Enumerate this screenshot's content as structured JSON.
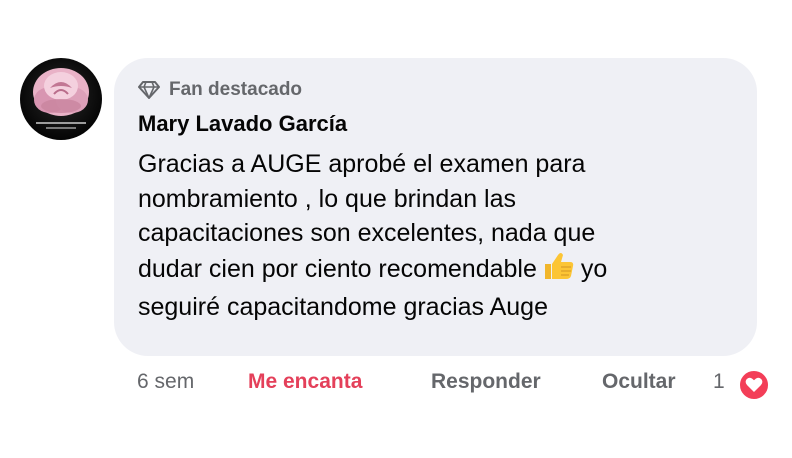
{
  "comment": {
    "badge_label": "Fan destacado",
    "badge_icon": "diamond-icon",
    "author": "Mary Lavado García",
    "avatar_icon": "rose-avatar",
    "lines": [
      "Gracias a AUGE aprobé el examen para",
      "nombramiento , lo que brindan las",
      "capacitaciones son excelentes, nada que",
      "dudar cien por ciento recomendable",
      "yo",
      "seguiré capacitandome gracias Auge"
    ],
    "emoji": "thumbs-up-icon"
  },
  "actions": {
    "time": "6 sem",
    "love": "Me encanta",
    "reply": "Responder",
    "hide": "Ocultar",
    "reaction_count": "1",
    "reaction_icon": "heart-icon"
  },
  "colors": {
    "bubble": "#eff0f5",
    "secondary_text": "#65676b",
    "love": "#e4405a",
    "heart": "#f33e58"
  }
}
